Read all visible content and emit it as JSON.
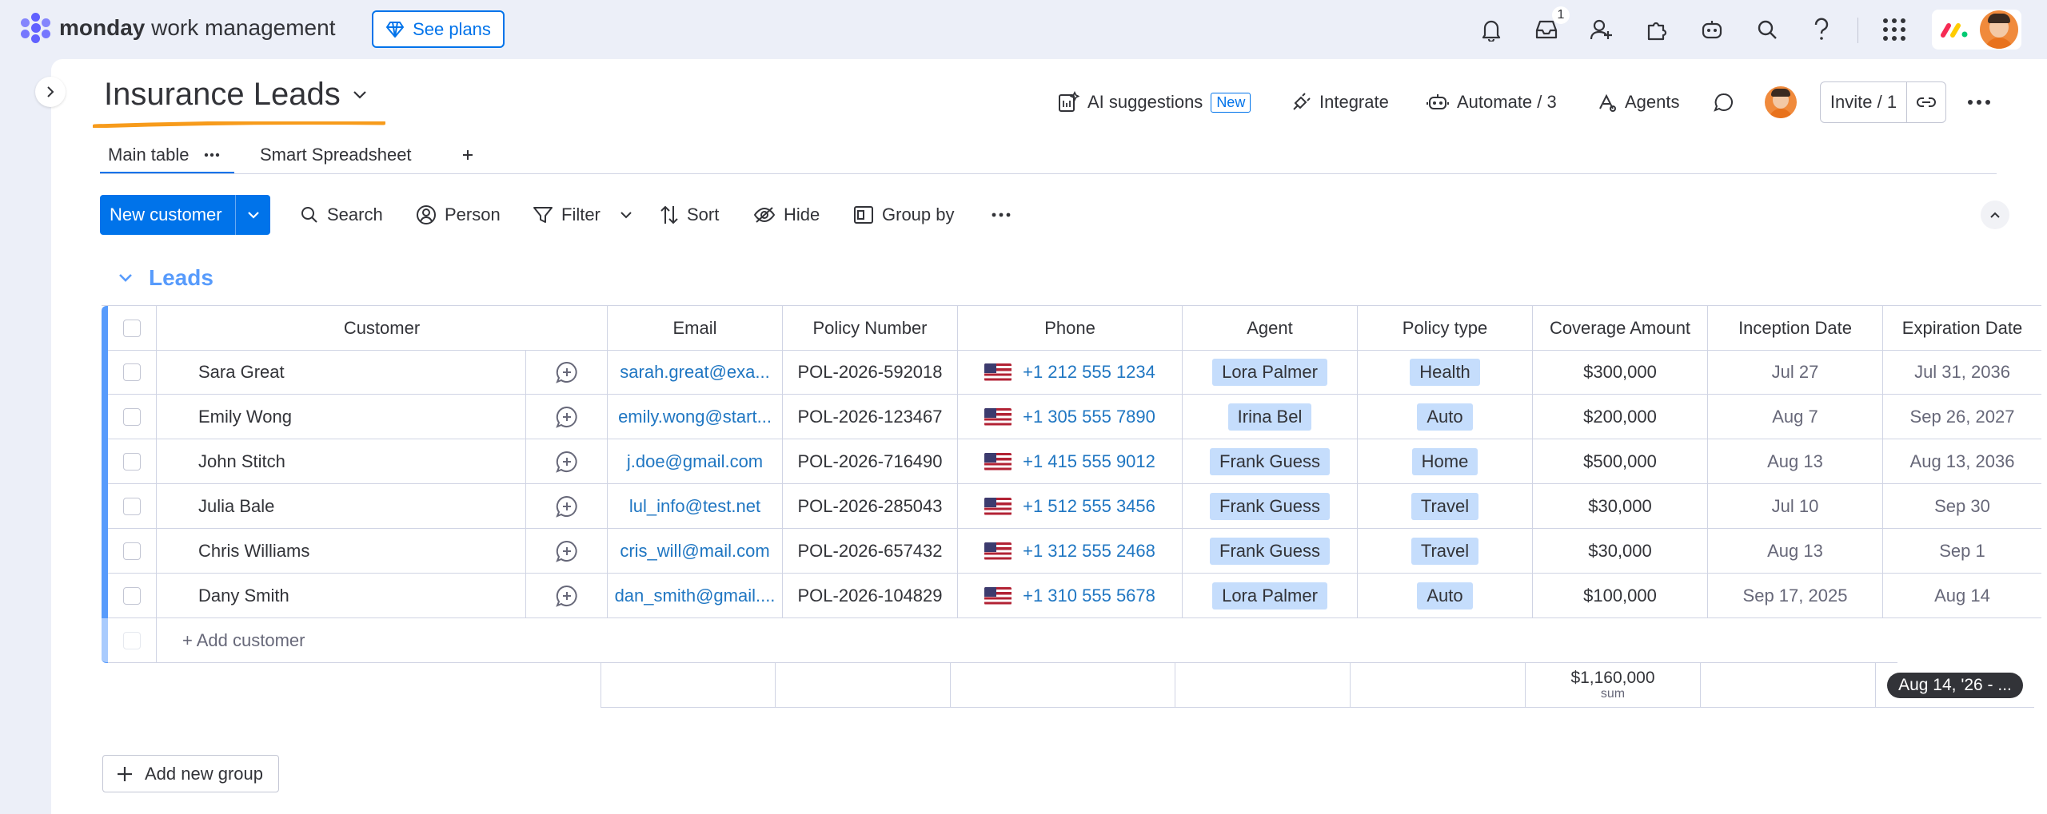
{
  "app": {
    "name_bold": "monday",
    "name_rest": " work management",
    "see_plans": "See plans",
    "inbox_count": "1"
  },
  "board": {
    "title": "Insurance Leads",
    "ai_suggestions": "AI suggestions",
    "new_badge": "New",
    "integrate": "Integrate",
    "automate": "Automate / 3",
    "agents": "Agents",
    "invite": "Invite / 1"
  },
  "tabs": [
    {
      "label": "Main table"
    },
    {
      "label": "Smart Spreadsheet"
    }
  ],
  "toolbar": {
    "new_item": "New customer",
    "search": "Search",
    "person": "Person",
    "filter": "Filter",
    "sort": "Sort",
    "hide": "Hide",
    "group_by": "Group by"
  },
  "group": {
    "title": "Leads",
    "color": "#579bfc",
    "columns": [
      "Customer",
      "Email",
      "Policy Number",
      "Phone",
      "Agent",
      "Policy type",
      "Coverage Amount",
      "Inception Date",
      "Expiration Date"
    ],
    "rows": [
      {
        "customer": "Sara Great",
        "email": "sarah.great@exa...",
        "policy": "POL-2026-592018",
        "phone": "+1 212 555 1234",
        "agent": "Lora Palmer",
        "type": "Health",
        "coverage": "$300,000",
        "inception": "Jul 27",
        "expiration": "Jul 31, 2036"
      },
      {
        "customer": "Emily Wong",
        "email": "emily.wong@start...",
        "policy": "POL-2026-123467",
        "phone": "+1 305 555 7890",
        "agent": "Irina Bel",
        "type": "Auto",
        "coverage": "$200,000",
        "inception": "Aug 7",
        "expiration": "Sep 26, 2027"
      },
      {
        "customer": "John Stitch",
        "email": "j.doe@gmail.com",
        "policy": "POL-2026-716490",
        "phone": "+1 415 555 9012",
        "agent": "Frank Guess",
        "type": "Home",
        "coverage": "$500,000",
        "inception": "Aug 13",
        "expiration": "Aug 13, 2036"
      },
      {
        "customer": "Julia Bale",
        "email": "lul_info@test.net",
        "policy": "POL-2026-285043",
        "phone": "+1 512 555 3456",
        "agent": "Frank Guess",
        "type": "Travel",
        "coverage": "$30,000",
        "inception": "Jul 10",
        "expiration": "Sep 30"
      },
      {
        "customer": "Chris Williams",
        "email": "cris_will@mail.com",
        "policy": "POL-2026-657432",
        "phone": "+1 312 555 2468",
        "agent": "Frank Guess",
        "type": "Travel",
        "coverage": "$30,000",
        "inception": "Aug 13",
        "expiration": "Sep 1"
      },
      {
        "customer": "Dany Smith",
        "email": "dan_smith@gmail....",
        "policy": "POL-2026-104829",
        "phone": "+1 310 555 5678",
        "agent": "Lora Palmer",
        "type": "Auto",
        "coverage": "$100,000",
        "inception": "Sep 17, 2025",
        "expiration": "Aug 14"
      }
    ],
    "add_item": "+ Add customer",
    "summary": {
      "coverage_sum": "$1,160,000",
      "coverage_label": "sum",
      "expiration_range": "Aug 14, '26 - ..."
    }
  },
  "add_group": "Add new group",
  "icons": {
    "bell": "bell-icon",
    "inbox": "inbox-icon",
    "invite": "add-person-icon",
    "apps": "puzzle-icon",
    "ai": "bot-icon",
    "search": "search-icon",
    "help": "help-icon",
    "menu": "grid-icon"
  }
}
